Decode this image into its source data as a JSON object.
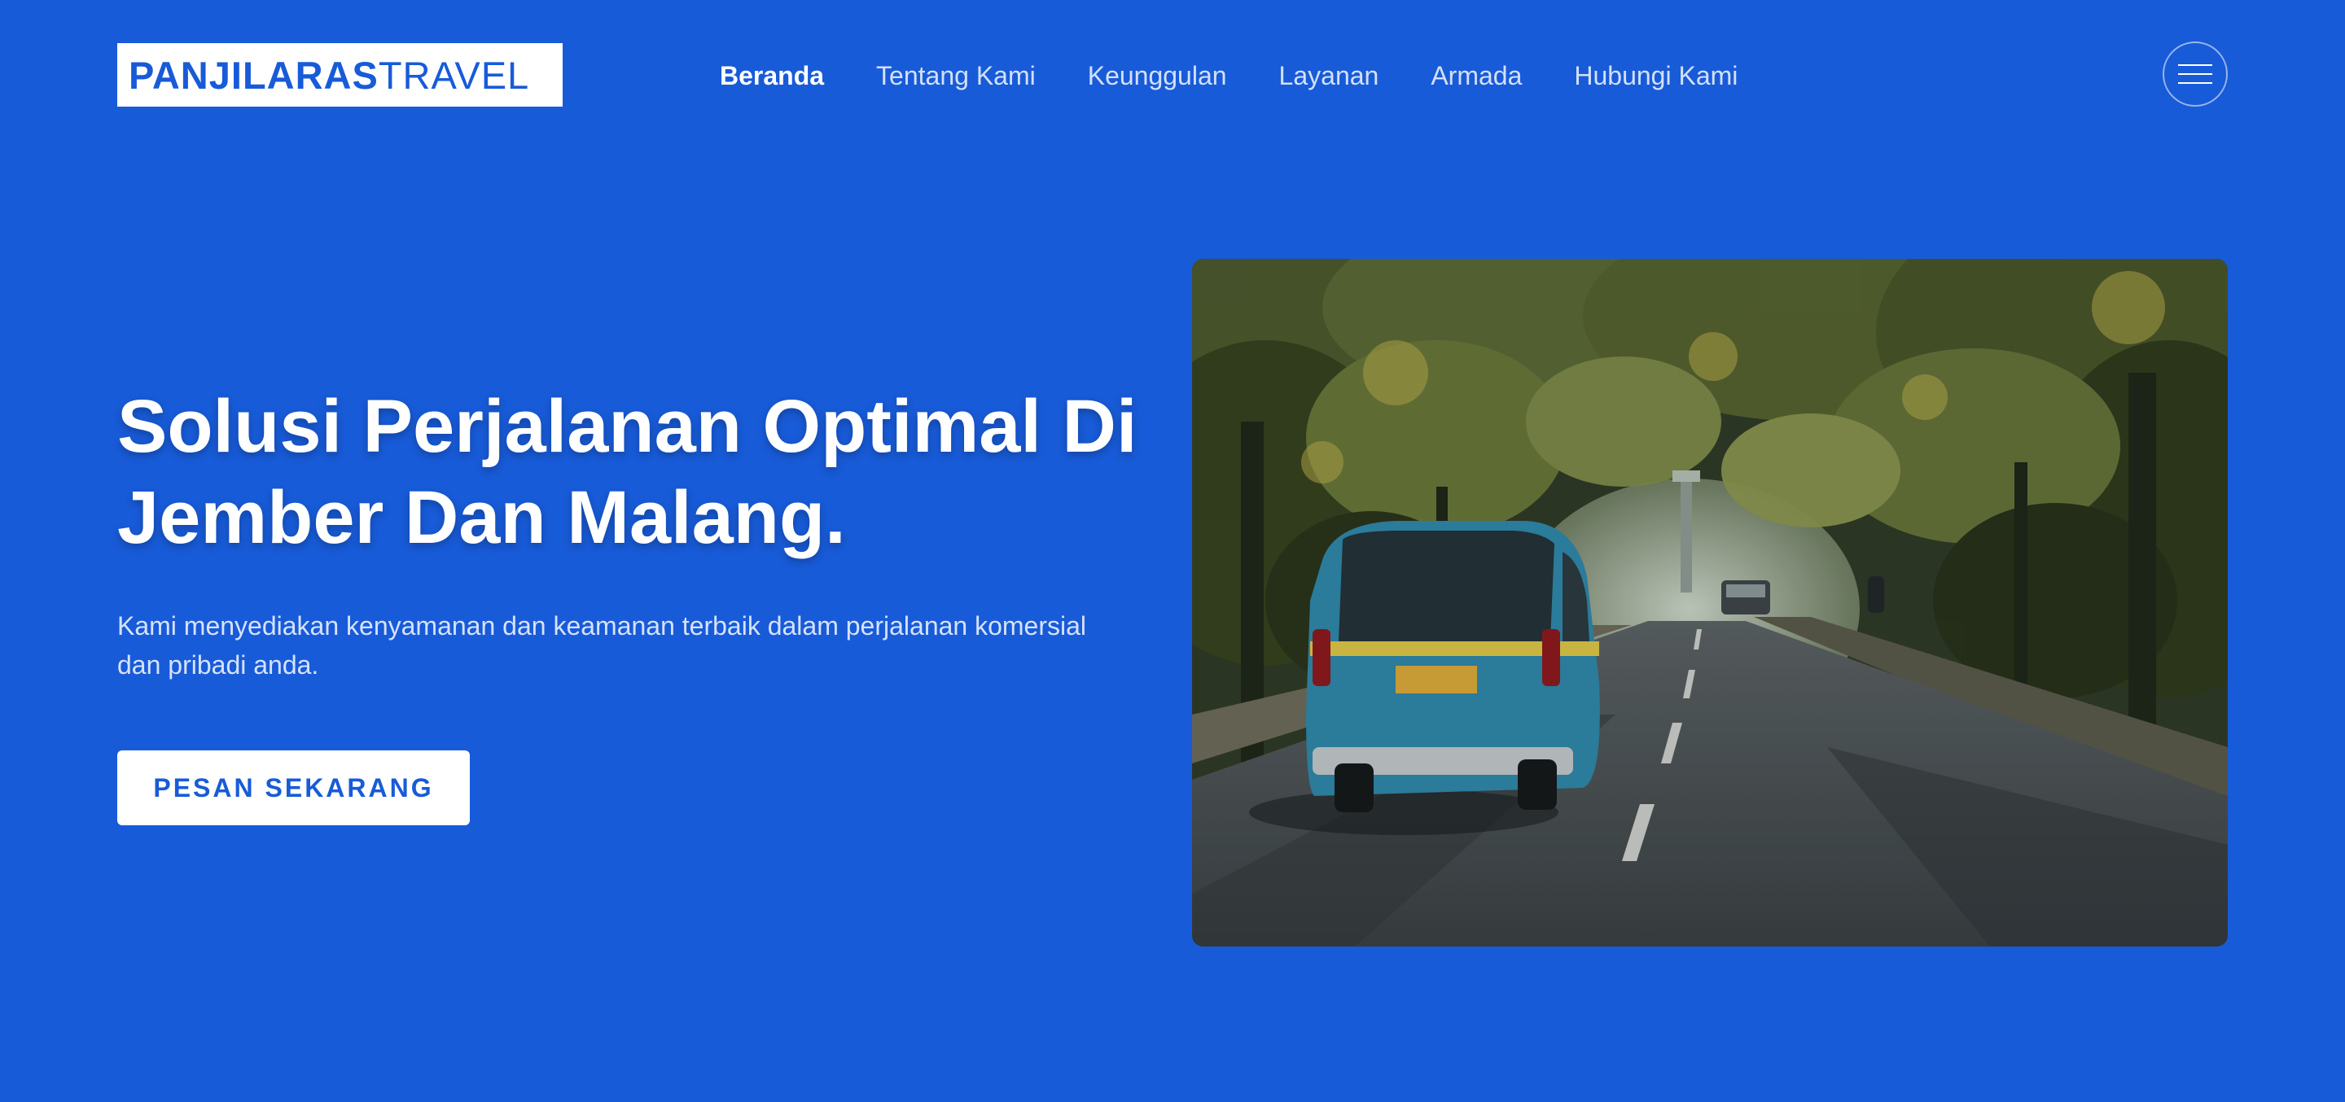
{
  "colors": {
    "background": "#185bd8",
    "logo_background": "#ffffff",
    "accent": "#185bd8",
    "nav_inactive": "#d3e0f8",
    "nav_active": "#ffffff"
  },
  "header": {
    "logo": {
      "bold": "PANJILARAS",
      "light": "TRAVEL"
    },
    "nav": {
      "beranda": "Beranda",
      "tentang_kami": "Tentang Kami",
      "keunggulan": "Keunggulan",
      "layanan": "Layanan",
      "armada": "Armada",
      "hubungi_kami": "Hubungi Kami"
    },
    "active_nav": "Beranda",
    "menu_icon": "hamburger-icon"
  },
  "hero": {
    "title_line1": "Solusi Perjalanan Optimal Di",
    "title_line2": "Jember Dan Malang.",
    "subtitle_line1": "Kami menyediakan kenyamanan dan keamanan terbaik dalam perjalanan komersial",
    "subtitle_line2": "dan pribadi anda.",
    "cta_label": "PESAN SEKARANG",
    "image_subject": "blue minibus angkot on tree-lined road"
  }
}
